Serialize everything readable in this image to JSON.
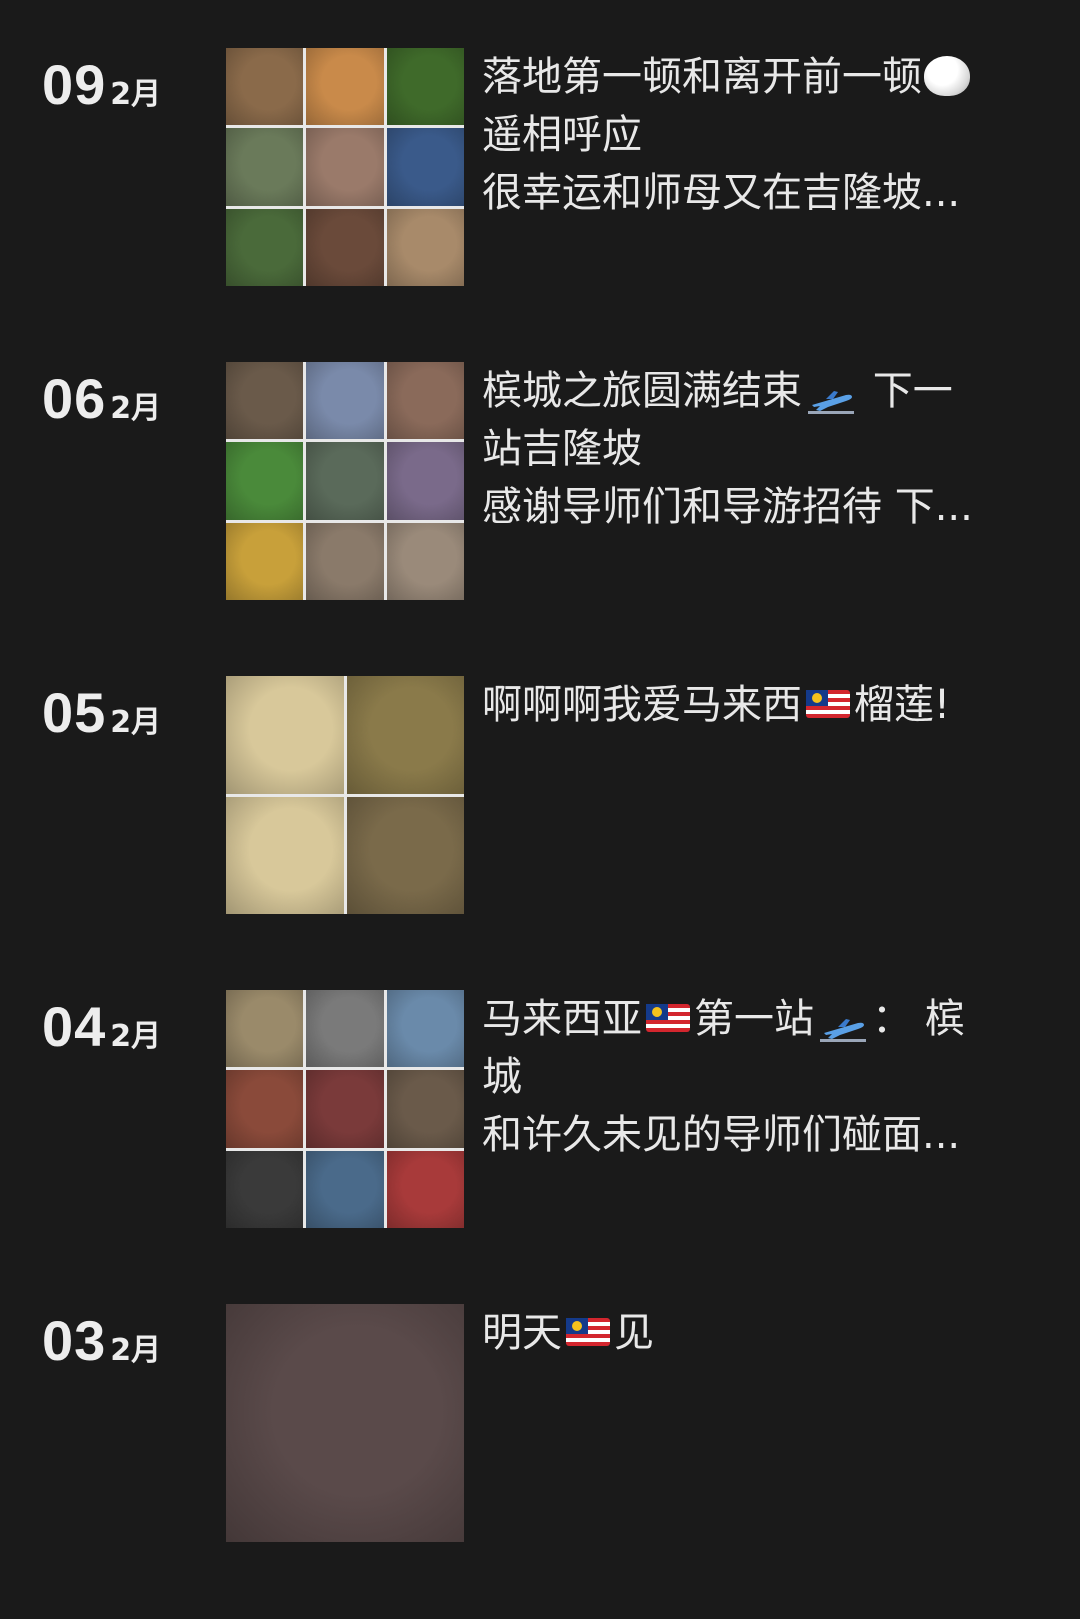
{
  "posts": [
    {
      "day": "09",
      "month": "2月",
      "lines": [
        [
          {
            "t": "text",
            "v": "落地第一顿和离开前一顿"
          },
          {
            "t": "icon",
            "icon": "rice-bowl-icon"
          }
        ],
        [
          {
            "t": "text",
            "v": "遥相呼应"
          }
        ],
        [
          {
            "t": "text",
            "v": "很幸运和师母又在吉隆坡..."
          }
        ]
      ],
      "thumb_layout": "3x3",
      "thumb_colors": [
        "#8a6a4a",
        "#c98a4a",
        "#3f6a2a",
        "#6a7a5a",
        "#9a7a6a",
        "#3a5a8a",
        "#4a6a3a",
        "#6a4a3a",
        "#a88a6a"
      ]
    },
    {
      "day": "06",
      "month": "2月",
      "lines": [
        [
          {
            "t": "text",
            "v": "槟城之旅圆满结束"
          },
          {
            "t": "icon",
            "icon": "airplane-icon"
          },
          {
            "t": "text",
            "v": " 下一"
          }
        ],
        [
          {
            "t": "text",
            "v": "站吉隆坡"
          }
        ],
        [
          {
            "t": "text",
            "v": "感谢导师们和导游招待 下..."
          }
        ]
      ],
      "thumb_layout": "3x3",
      "thumb_colors": [
        "#6a5a4a",
        "#7a8aaa",
        "#8a6a5a",
        "#4a8a3a",
        "#5a6a5a",
        "#7a6a8a",
        "#c8a03a",
        "#8a7a6a",
        "#9a8a7a"
      ]
    },
    {
      "day": "05",
      "month": "2月",
      "lines": [
        [
          {
            "t": "text",
            "v": "啊啊啊我爱马来西"
          },
          {
            "t": "icon",
            "icon": "malaysia-flag-icon"
          },
          {
            "t": "text",
            "v": "榴莲!"
          }
        ]
      ],
      "thumb_layout": "2x2",
      "thumb_colors": [
        "#d8c89a",
        "#8a7a4a",
        "#d8c89a",
        "#7a6a4a"
      ]
    },
    {
      "day": "04",
      "month": "2月",
      "lines": [
        [
          {
            "t": "text",
            "v": "马来西亚"
          },
          {
            "t": "icon",
            "icon": "malaysia-flag-icon"
          },
          {
            "t": "text",
            "v": "第一站"
          },
          {
            "t": "icon",
            "icon": "airplane-icon"
          },
          {
            "t": "text",
            "v": "：  槟"
          }
        ],
        [
          {
            "t": "text",
            "v": "城"
          }
        ],
        [
          {
            "t": "text",
            "v": "和许久未见的导师们碰面..."
          }
        ]
      ],
      "thumb_layout": "3x3",
      "thumb_colors": [
        "#9a8a6a",
        "#7a7a7a",
        "#6a8aaa",
        "#8a4a3a",
        "#7a3a3a",
        "#6a5a4a",
        "#3a3a3a",
        "#4a6a8a",
        "#a83a3a"
      ]
    },
    {
      "day": "03",
      "month": "2月",
      "lines": [
        [
          {
            "t": "text",
            "v": "明天"
          },
          {
            "t": "icon",
            "icon": "malaysia-flag-icon"
          },
          {
            "t": "text",
            "v": "见"
          }
        ]
      ],
      "thumb_layout": "1x1",
      "thumb_colors": [
        "#5a4a4a"
      ]
    }
  ]
}
